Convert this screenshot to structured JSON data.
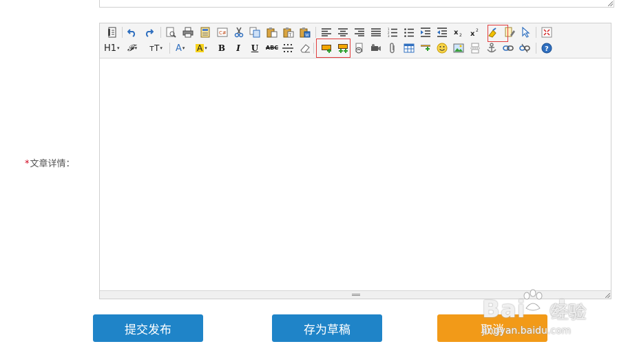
{
  "form": {
    "required_mark": "*",
    "article_label": "文章详情："
  },
  "toolbar": {
    "row2": {
      "heading_label": "H1",
      "font_family_label": "𝓕",
      "font_size_label": "тT",
      "font_color_label": "A",
      "bg_color_label": "A",
      "bold_label": "B",
      "italic_label": "I",
      "underline_label": "U",
      "strike_label": "ABC"
    }
  },
  "buttons": {
    "submit_label": "提交发布",
    "draft_label": "存为草稿",
    "cancel_label": "取消"
  },
  "watermark": {
    "logo": "Bai",
    "logo2": "du",
    "cn": "经验",
    "url": "jingyan.baidu.com"
  },
  "colors": {
    "primary_button": "#1f84c8",
    "cancel_button": "#f29a18",
    "highlight_box": "#e23b3b",
    "required_mark": "#d0021b"
  }
}
